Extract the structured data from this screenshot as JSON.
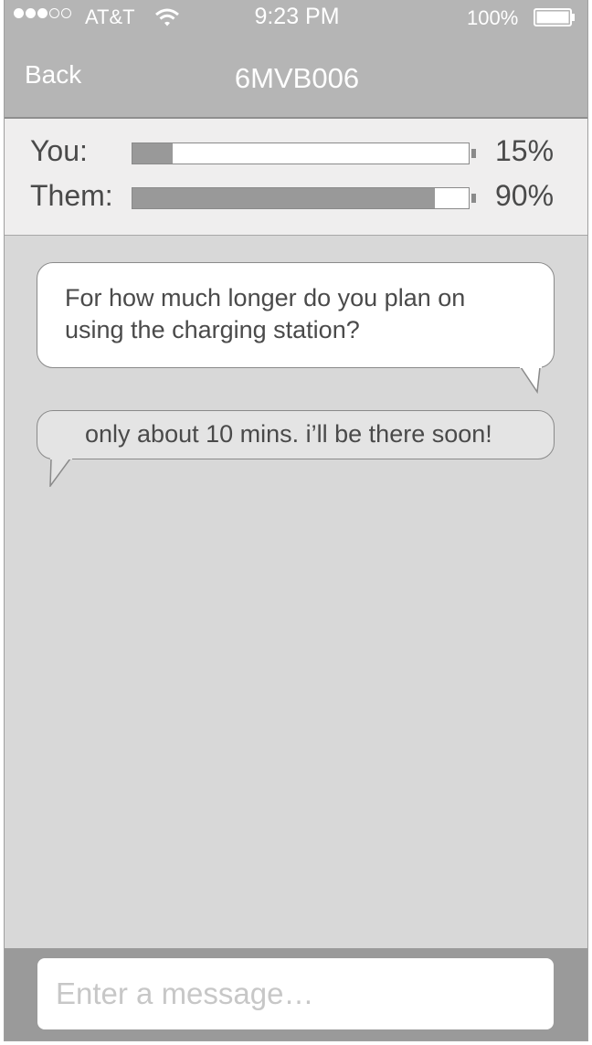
{
  "status_bar": {
    "carrier": "AT&T",
    "time": "9:23 PM",
    "battery": "100%"
  },
  "nav": {
    "back_label": "Back",
    "title": "6MVB006"
  },
  "charge_levels": [
    {
      "label": "You:",
      "percent_text": "15%",
      "level": 0.12
    },
    {
      "label": "Them:",
      "percent_text": "90%",
      "level": 0.9
    }
  ],
  "messages": [
    {
      "sender": "me",
      "text": "For how much longer do you plan on using the charging station?"
    },
    {
      "sender": "them",
      "text": "only about 10 mins. i’ll be there soon!"
    }
  ],
  "composer": {
    "placeholder": "Enter a message…"
  },
  "colors": {
    "header_bg": "#b5b5b5",
    "panel_bg": "#efeeee",
    "chat_bg": "#d8d8d8",
    "bar_fill": "#999999",
    "composer_bg": "#9a9a9a"
  }
}
